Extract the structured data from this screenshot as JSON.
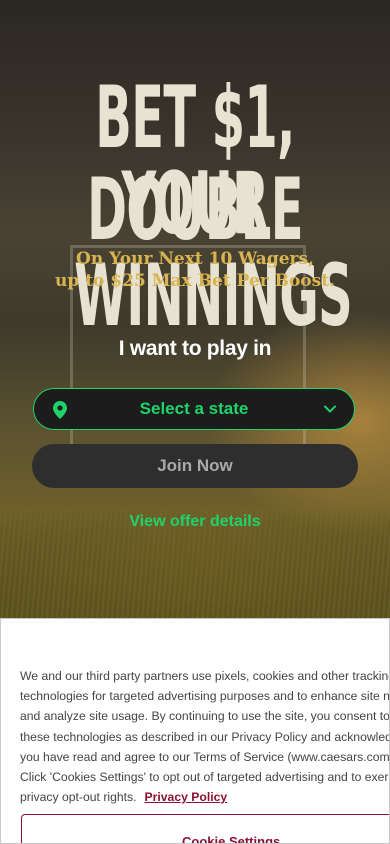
{
  "hero": {
    "headline_line1": "BET $1, DOUBLE",
    "headline_line2": "YOUR WINNINGS",
    "subheadline_line1": "On Your Next 10 Wagers,",
    "subheadline_line2": "up to $25 Max Bet Per Boost.",
    "play_prompt": "I want to play in",
    "state_select": {
      "label": "Select a state",
      "icon": "location-pin-icon",
      "chevron": "chevron-down-icon"
    },
    "join_button": "Join Now",
    "offer_link": "View offer details"
  },
  "cookie_banner": {
    "lines": [
      "We and our third party partners use pixels, cookies and other tracking",
      "technologies for targeted advertising purposes and to enhance site navig",
      "and analyze site usage. By continuing to use the site, you consent to the",
      "these technologies as described in our Privacy Policy and acknowledge th",
      "you have read and agree to our Terms of Service (www.caesars.com/terr",
      "Click 'Cookies Settings' to opt out of targeted advertising and to exercise",
      "privacy opt-out rights."
    ],
    "privacy_link": "Privacy Policy",
    "settings_button": "Cookie Settings"
  },
  "colors": {
    "accent_green": "#1fd36a",
    "gold_text": "#d9b451",
    "cookie_accent": "#8a1232"
  }
}
